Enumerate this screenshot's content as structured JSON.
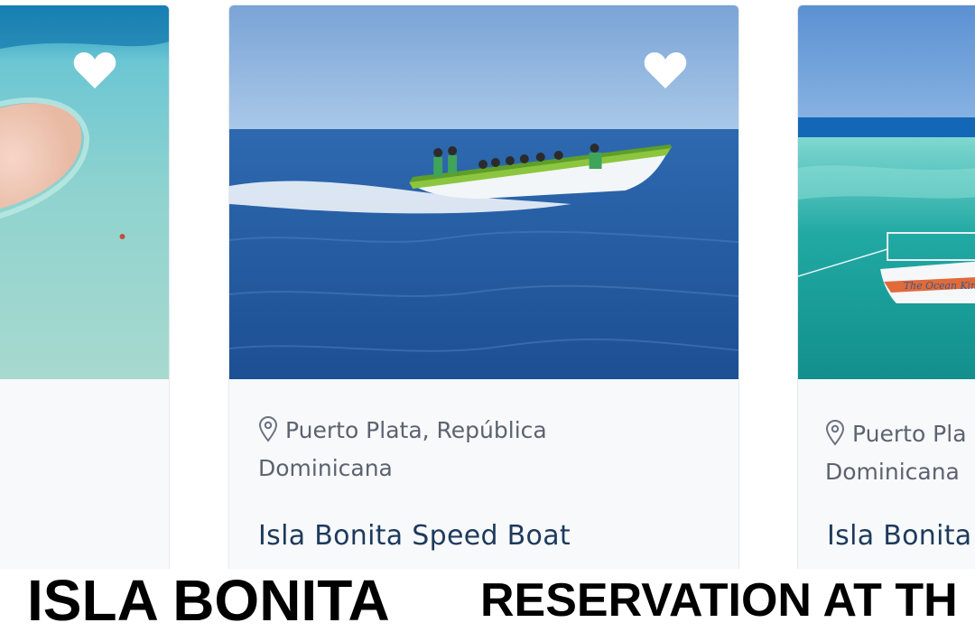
{
  "cards": [
    {
      "location": "",
      "title": "",
      "favorite": true,
      "photo": "pink-sandbar-lagoon"
    },
    {
      "location_line1": "Puerto Plata, República",
      "location_line2": "Dominicana",
      "title": "Isla Bonita Speed Boat",
      "favorite": true,
      "photo": "green-speedboat-ocean"
    },
    {
      "location_line1": "Puerto Pla",
      "location_line2": "Dominicana",
      "title": "Isla Bonita",
      "photo": "white-catamaran-reef"
    }
  ],
  "captions": {
    "left": "ISLA BONITA",
    "right": "RESERVATION AT TH"
  },
  "icons": {
    "favorite": "heart-icon",
    "location": "map-pin-icon"
  },
  "colors": {
    "title": "#1d3a5c",
    "location_text": "#5c6370",
    "card_background": "#f8f9fb",
    "caption_text": "#000000"
  }
}
